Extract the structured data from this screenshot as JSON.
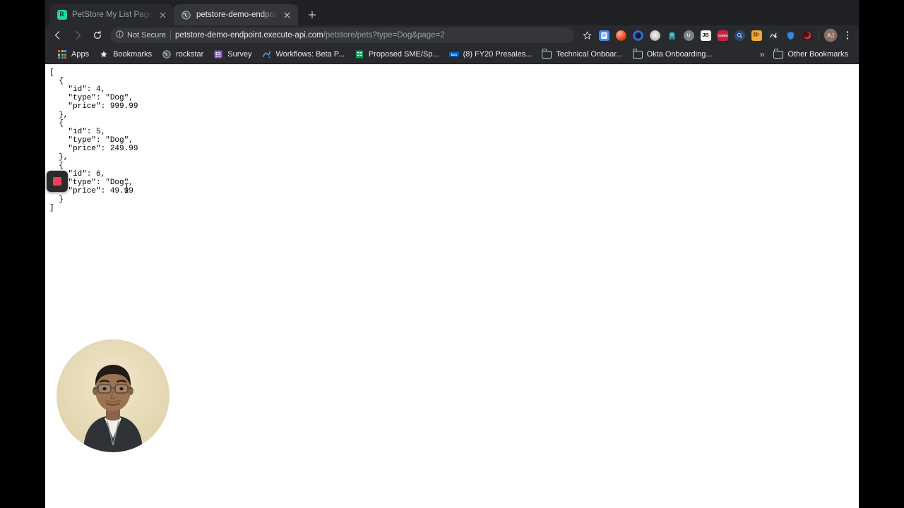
{
  "browser": {
    "tabs": [
      {
        "title": "PetStore My List Page Java Pe",
        "favicon": "rainforest-icon",
        "active": false
      },
      {
        "title": "petstore-demo-endpoint.exec",
        "favicon": "globe-icon",
        "active": true
      }
    ],
    "new_tab_label": "+",
    "nav": {
      "back": "back-arrow-icon",
      "forward": "forward-arrow-icon",
      "reload": "reload-icon"
    },
    "omnibox": {
      "security_label": "Not Secure",
      "security_icon": "info-circle-icon",
      "url_host": "petstore-demo-endpoint.execute-api.com",
      "url_path": "/petstore/pets?type=Dog&page=2",
      "bookmark_star": "star-icon"
    },
    "extensions": [
      {
        "name": "google-docs-extension",
        "label": "",
        "color": "#4285f4"
      },
      {
        "name": "red-ball-extension",
        "label": "",
        "color": "#e8441f"
      },
      {
        "name": "blue-ring-extension",
        "label": "",
        "color": "#1a73e8"
      },
      {
        "name": "grey-circle-extension",
        "label": "",
        "color": "#d7d7d7"
      },
      {
        "name": "teal-octopus-extension",
        "label": "",
        "color": "#35c4c4"
      },
      {
        "name": "grey-u-extension",
        "label": "U",
        "color": "#9aa0a6"
      },
      {
        "name": "jetbrains-extension",
        "label": "JB",
        "color": "#f4f4f4"
      },
      {
        "name": "coveo-extension",
        "label": "COVEO",
        "color": "#cc1f3c"
      },
      {
        "name": "search-extension",
        "label": "",
        "color": "#2f6bbd"
      },
      {
        "name": "orange-grid-extension",
        "label": "",
        "color": "#f2a93b"
      },
      {
        "name": "bw-extension",
        "label": "",
        "color": "#2c2f33"
      },
      {
        "name": "blue-shield-extension",
        "label": "",
        "color": "#2e86de"
      },
      {
        "name": "spiral-extension",
        "label": "",
        "color": "#b02a37"
      }
    ],
    "profile": {
      "initials": "AJ"
    },
    "menu_icon": "kebab-menu-icon",
    "bookmarks": [
      {
        "label": "Apps",
        "icon": "apps-grid-icon"
      },
      {
        "label": "Bookmarks",
        "icon": "star-icon"
      },
      {
        "label": "rockstar",
        "icon": "globe-icon"
      },
      {
        "label": "Survey",
        "icon": "survey-icon"
      },
      {
        "label": "Workflows: Beta P...",
        "icon": "workflows-icon"
      },
      {
        "label": "Proposed SME/Sp...",
        "icon": "sheets-icon"
      },
      {
        "label": "(8) FY20 Presales...",
        "icon": "box-icon"
      },
      {
        "label": "Technical Onboar...",
        "icon": "folder-icon"
      },
      {
        "label": "Okta Onboarding...",
        "icon": "folder-icon"
      }
    ],
    "bookmarks_overflow": "»",
    "other_bookmarks": {
      "label": "Other Bookmarks",
      "icon": "folder-icon"
    }
  },
  "page": {
    "content_type": "json-response",
    "raw": "[\n  {\n    \"id\": 4,\n    \"type\": \"Dog\",\n    \"price\": 999.99\n  },\n  {\n    \"id\": 5,\n    \"type\": \"Dog\",\n    \"price\": 249.99\n  },\n  {\n    \"id\": 6,\n    \"type\": \"Dog\",\n    \"price\": 49.99\n  }\n]",
    "records": [
      {
        "id": 4,
        "type": "Dog",
        "price": 999.99
      },
      {
        "id": 5,
        "type": "Dog",
        "price": 249.99
      },
      {
        "id": 6,
        "type": "Dog",
        "price": 49.99
      }
    ]
  },
  "overlays": {
    "recording_indicator": {
      "name": "stop-recording-button",
      "shape": "red-square"
    },
    "webcam": {
      "name": "webcam-overlay",
      "background_color": "#e8ddbd"
    },
    "text_cursor": {
      "name": "text-cursor"
    }
  }
}
